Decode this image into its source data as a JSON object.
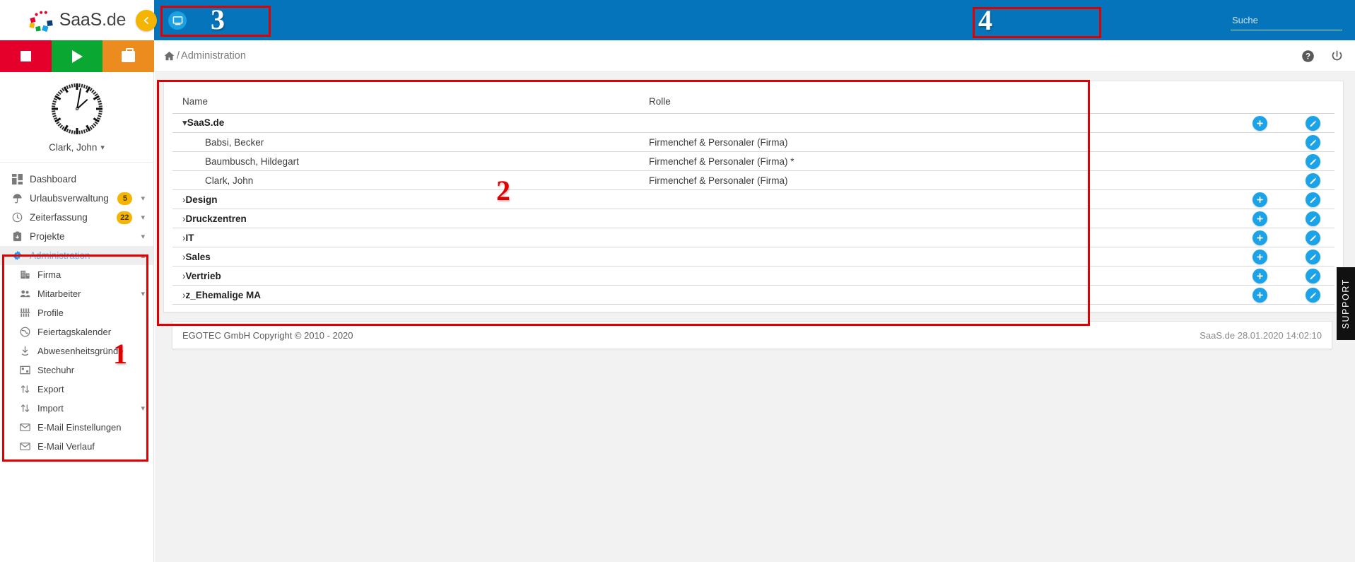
{
  "brand": {
    "name": "SaaS",
    "tld": ".de"
  },
  "topbar": {
    "collapse_label": "‹",
    "monitor_icon": "monitor-icon",
    "search_placeholder": "Suche",
    "search_value": "",
    "blue": "#0674bb"
  },
  "quick_actions": [
    {
      "name": "stop-button",
      "icon": "stop-square-icon",
      "color": "#e4002b"
    },
    {
      "name": "start-button",
      "icon": "play-triangle-icon",
      "color": "#0aa832"
    },
    {
      "name": "project-button",
      "icon": "briefcase-icon",
      "color": "#ec8b1e"
    }
  ],
  "profile": {
    "user_name": "Clark, John",
    "clock_icon": "analog-clock-icon",
    "caret": "⌄"
  },
  "sidebar": {
    "items": [
      {
        "label": "Dashboard",
        "icon": "dashboard-icon",
        "badge": "",
        "chevron": "",
        "active": false,
        "sub": false
      },
      {
        "label": "Urlaubsverwaltung",
        "icon": "umbrella-icon",
        "badge": "5",
        "chevron": "⌄",
        "active": false,
        "sub": false
      },
      {
        "label": "Zeiterfassung",
        "icon": "clock-icon",
        "badge": "22",
        "chevron": "⌄",
        "active": false,
        "sub": false
      },
      {
        "label": "Projekte",
        "icon": "clipboard-icon",
        "badge": "",
        "chevron": "⌄",
        "active": false,
        "sub": false
      },
      {
        "label": "Administration",
        "icon": "gear-icon",
        "badge": "",
        "chevron": "⌃",
        "active": true,
        "sub": false
      },
      {
        "label": "Firma",
        "icon": "building-icon",
        "badge": "",
        "chevron": "",
        "active": false,
        "sub": true
      },
      {
        "label": "Mitarbeiter",
        "icon": "people-icon",
        "badge": "",
        "chevron": "⌄",
        "active": false,
        "sub": true
      },
      {
        "label": "Profile",
        "icon": "sliders-icon",
        "badge": "",
        "chevron": "",
        "active": false,
        "sub": true
      },
      {
        "label": "Feiertagskalender",
        "icon": "globe-icon",
        "badge": "",
        "chevron": "",
        "active": false,
        "sub": true
      },
      {
        "label": "Abwesenheitsgründe",
        "icon": "download-icon",
        "badge": "",
        "chevron": "",
        "active": false,
        "sub": true
      },
      {
        "label": "Stechuhr",
        "icon": "punch-clock-icon",
        "badge": "",
        "chevron": "",
        "active": false,
        "sub": true
      },
      {
        "label": "Export",
        "icon": "updown-arrows-icon",
        "badge": "",
        "chevron": "",
        "active": false,
        "sub": true
      },
      {
        "label": "Import",
        "icon": "updown-arrows-icon",
        "badge": "",
        "chevron": "⌄",
        "active": false,
        "sub": true
      },
      {
        "label": "E-Mail Einstellungen",
        "icon": "envelope-icon",
        "badge": "",
        "chevron": "",
        "active": false,
        "sub": true
      },
      {
        "label": "E-Mail Verlauf",
        "icon": "envelope-icon",
        "badge": "",
        "chevron": "",
        "active": false,
        "sub": true
      }
    ]
  },
  "breadcrumb": {
    "home_icon": "home-icon",
    "separator": "/",
    "current": "Administration"
  },
  "header_icons": [
    {
      "name": "help-icon",
      "glyph": "?"
    },
    {
      "name": "power-icon",
      "glyph": "⏻"
    }
  ],
  "table": {
    "columns": [
      "Name",
      "Rolle"
    ],
    "rows": [
      {
        "name": "SaaS.de",
        "role": "",
        "type": "group",
        "expanded": true,
        "twisty": "⌄",
        "add": true,
        "edit": true
      },
      {
        "name": "Babsi, Becker",
        "role": "Firmenchef & Personaler (Firma)",
        "type": "member",
        "expanded": false,
        "twisty": "",
        "add": false,
        "edit": true
      },
      {
        "name": "Baumbusch, Hildegart",
        "role": "Firmenchef & Personaler (Firma) *",
        "type": "member",
        "expanded": false,
        "twisty": "",
        "add": false,
        "edit": true
      },
      {
        "name": "Clark, John",
        "role": "Firmenchef & Personaler (Firma)",
        "type": "member",
        "expanded": false,
        "twisty": "",
        "add": false,
        "edit": true
      },
      {
        "name": "Design",
        "role": "",
        "type": "group",
        "expanded": false,
        "twisty": "›",
        "add": true,
        "edit": true
      },
      {
        "name": "Druckzentren",
        "role": "",
        "type": "group",
        "expanded": false,
        "twisty": "›",
        "add": true,
        "edit": true
      },
      {
        "name": "IT",
        "role": "",
        "type": "group",
        "expanded": false,
        "twisty": "›",
        "add": true,
        "edit": true
      },
      {
        "name": "Sales",
        "role": "",
        "type": "group",
        "expanded": false,
        "twisty": "›",
        "add": true,
        "edit": true
      },
      {
        "name": "Vertrieb",
        "role": "",
        "type": "group",
        "expanded": false,
        "twisty": "›",
        "add": true,
        "edit": true
      },
      {
        "name": "z_Ehemalige MA",
        "role": "",
        "type": "group",
        "expanded": false,
        "twisty": "›",
        "add": true,
        "edit": true
      }
    ]
  },
  "footer": {
    "left": "EGOTEC GmbH Copyright © 2010 - 2020",
    "right": "SaaS.de  28.01.2020 14:02:10"
  },
  "support_tab": {
    "label": "SUPPORT"
  },
  "annotations": [
    {
      "id": "1",
      "label": "1",
      "target": "sidebar-administration-section"
    },
    {
      "id": "2",
      "label": "2",
      "target": "employee-table-panel"
    },
    {
      "id": "3",
      "label": "3",
      "target": "monitor-button"
    },
    {
      "id": "4",
      "label": "4",
      "target": "search-field"
    }
  ]
}
